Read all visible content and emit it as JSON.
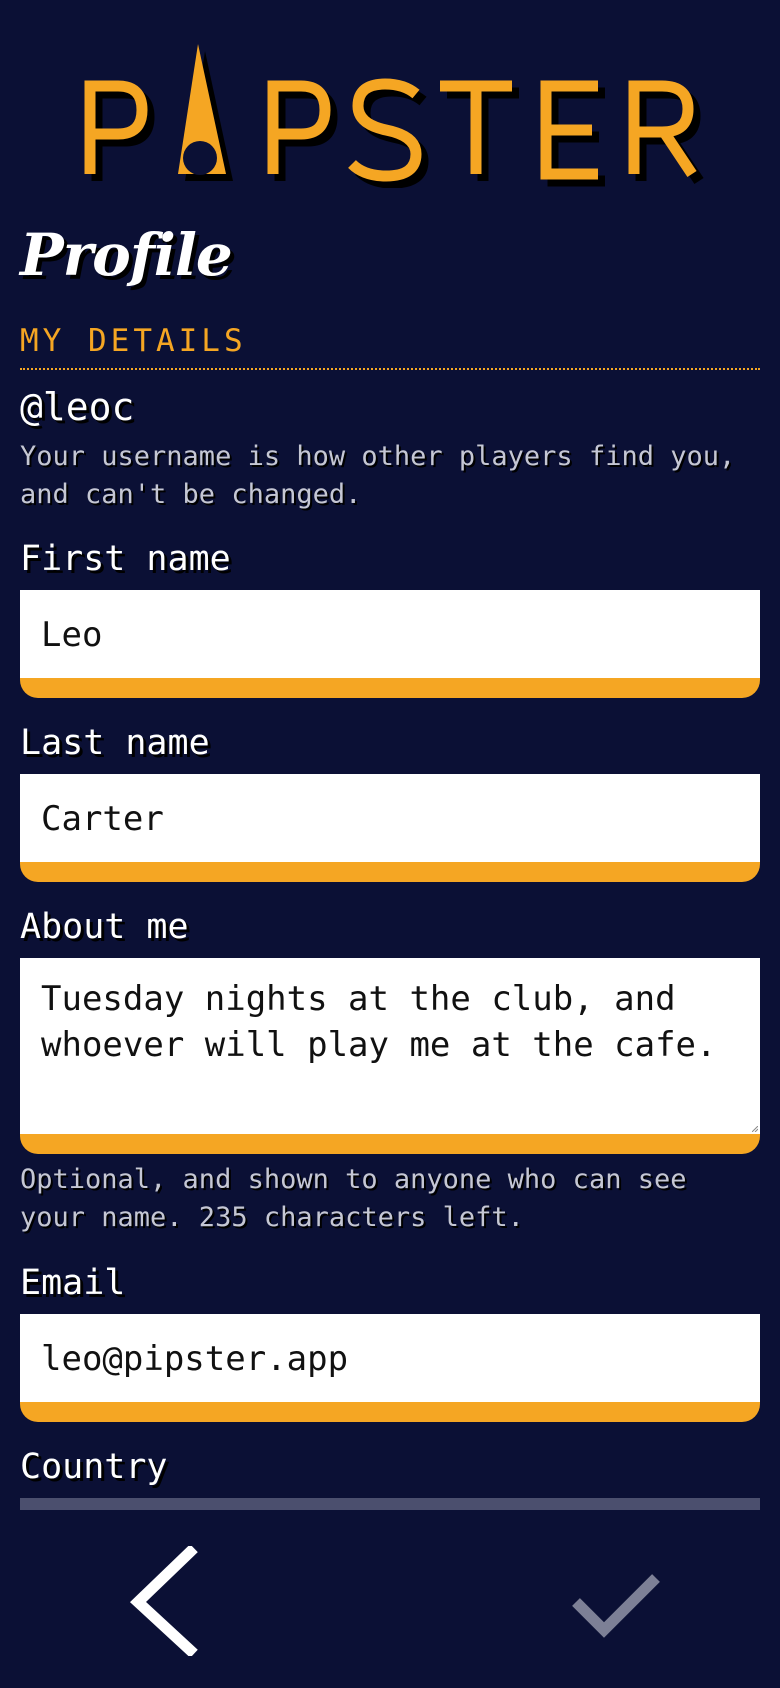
{
  "logo": {
    "text": "PIPSTER",
    "color": "#f5a623"
  },
  "page_title": "Profile",
  "section": {
    "title": "MY DETAILS"
  },
  "profile": {
    "username": "@leoc",
    "username_hint": "Your username is how other players find you, and can't be changed."
  },
  "form": {
    "first_name": {
      "label": "First name",
      "value": "Leo"
    },
    "last_name": {
      "label": "Last name",
      "value": "Carter"
    },
    "about_me": {
      "label": "About me",
      "value": "Tuesday nights at the club, and whoever will play me at the cafe.",
      "hint": "Optional, and shown to anyone who can see your name. 235 characters left."
    },
    "email": {
      "label": "Email",
      "value": "leo@pipster.app"
    },
    "country": {
      "label": "Country"
    }
  },
  "nav": {
    "back_icon": "chevron-left-icon",
    "save_icon": "check-icon"
  },
  "colors": {
    "background": "#0b1035",
    "accent": "#f5a623",
    "field_bg": "#ffffff",
    "hint_text": "#c5c7d4",
    "disabled_icon": "#7d8096"
  }
}
